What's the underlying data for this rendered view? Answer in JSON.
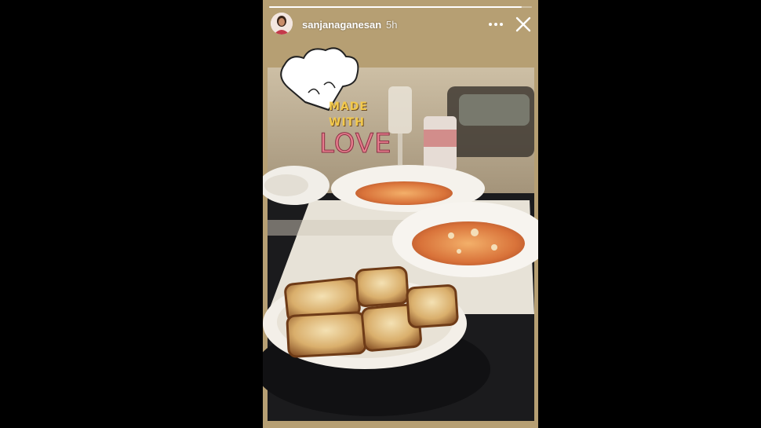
{
  "story": {
    "username": "sanjanaganesan",
    "timestamp": "5h",
    "progress": 0.96,
    "sticker": {
      "line1": "MADE",
      "line2": "WITH",
      "line3": "LOVE",
      "icon": "chef-hat-icon"
    },
    "icons": {
      "more": "more-dots-icon",
      "close": "close-icon"
    }
  },
  "colors": {
    "background": "#000000",
    "story_border": "#b69f73",
    "sticker_yellow": "#f2c94c",
    "sticker_pink": "#e57c8c"
  }
}
